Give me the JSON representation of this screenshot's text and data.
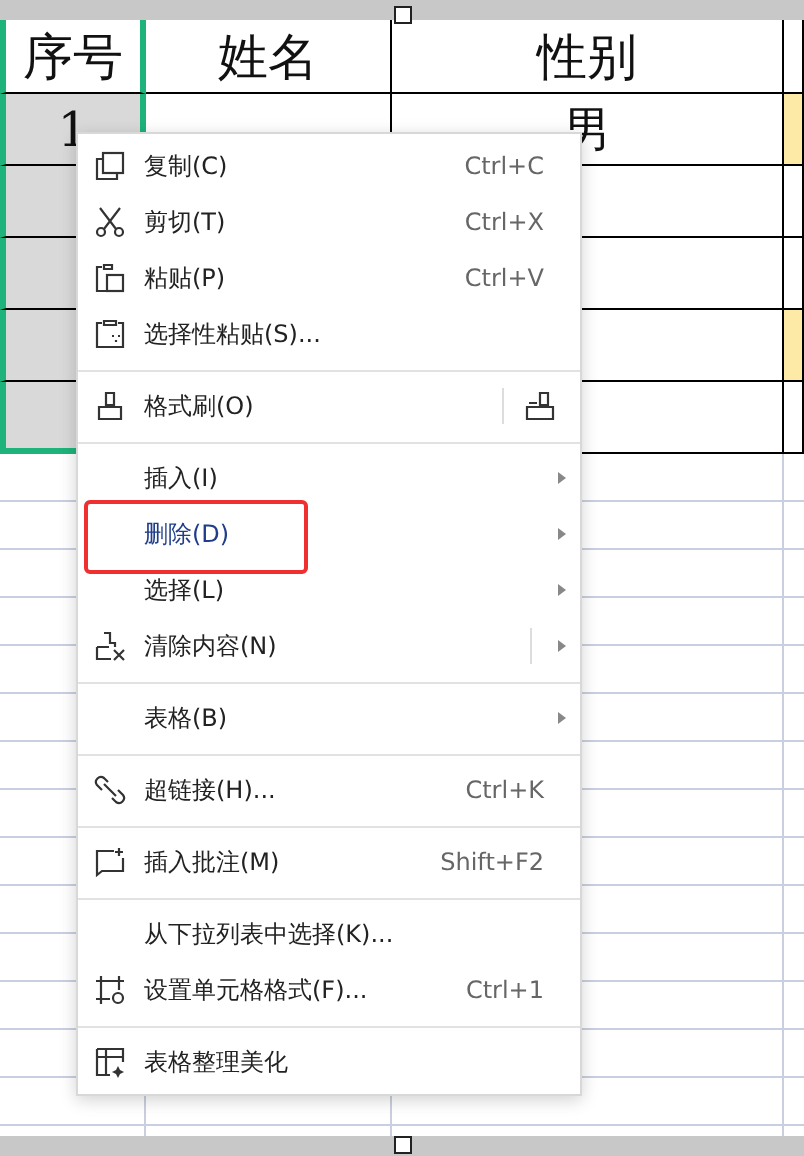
{
  "sheet": {
    "columns": [
      {
        "label": "序号",
        "selected": true
      },
      {
        "label": "姓名",
        "selected": false
      },
      {
        "label": "性别",
        "selected": false
      }
    ],
    "rows": [
      {
        "no": "1",
        "gender": "男",
        "highlighted": true
      },
      {
        "highlighted": false
      },
      {
        "highlighted": false
      },
      {
        "highlighted": true
      },
      {
        "highlighted": false
      }
    ]
  },
  "context_menu": {
    "groups": [
      [
        {
          "kind": "copy",
          "label": "复制(C)",
          "shortcut": "Ctrl+C",
          "submenu": false,
          "highlighted": false
        },
        {
          "kind": "cut",
          "label": "剪切(T)",
          "shortcut": "Ctrl+X",
          "submenu": false,
          "highlighted": false
        },
        {
          "kind": "paste",
          "label": "粘贴(P)",
          "shortcut": "Ctrl+V",
          "submenu": false,
          "highlighted": false
        },
        {
          "kind": "paste-special",
          "label": "选择性粘贴(S)...",
          "submenu": false,
          "highlighted": false
        }
      ],
      [
        {
          "kind": "format-painter",
          "label": "格式刷(O)",
          "submenu": false,
          "highlighted": false
        }
      ],
      [
        {
          "kind": "plain",
          "label": "插入(I)",
          "submenu": true,
          "highlighted": false
        },
        {
          "kind": "plain",
          "label": "删除(D)",
          "submenu": true,
          "highlighted": true
        },
        {
          "kind": "plain",
          "label": "选择(L)",
          "submenu": true,
          "highlighted": false
        },
        {
          "kind": "clear",
          "label": "清除内容(N)",
          "submenu": true,
          "highlighted": false
        }
      ],
      [
        {
          "kind": "plain",
          "label": "表格(B)",
          "submenu": true,
          "highlighted": false
        }
      ],
      [
        {
          "kind": "link",
          "label": "超链接(H)...",
          "shortcut": "Ctrl+K",
          "submenu": false,
          "highlighted": false
        }
      ],
      [
        {
          "kind": "comment",
          "label": "插入批注(M)",
          "shortcut": "Shift+F2",
          "submenu": false,
          "highlighted": false
        }
      ],
      [
        {
          "kind": "plain",
          "label": "从下拉列表中选择(K)...",
          "submenu": false,
          "highlighted": false
        },
        {
          "kind": "format-cells",
          "label": "设置单元格格式(F)...",
          "shortcut": "Ctrl+1",
          "submenu": false,
          "highlighted": false
        }
      ],
      [
        {
          "kind": "beautify",
          "label": "表格整理美化",
          "submenu": false,
          "highlighted": false
        }
      ]
    ]
  }
}
